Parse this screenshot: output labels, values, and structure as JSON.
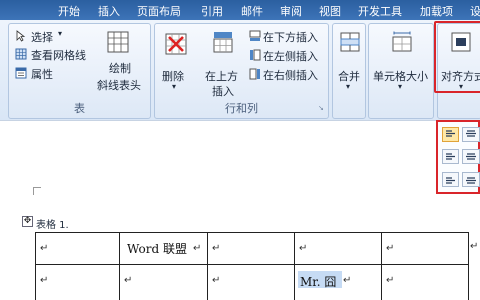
{
  "tabs": [
    "开始",
    "插入",
    "页面布局",
    "引用",
    "邮件",
    "审阅",
    "视图",
    "开发工具",
    "加载项",
    "设"
  ],
  "table_group": {
    "select": "选择",
    "view_gridlines": "查看网格线",
    "properties": "属性",
    "draw_line1": "绘制",
    "draw_line2": "斜线表头",
    "title": "表"
  },
  "rows_group": {
    "delete": "删除",
    "insert_above_line1": "在上方",
    "insert_above_line2": "插入",
    "insert_below": "在下方插入",
    "insert_left": "在左侧插入",
    "insert_right": "在右侧插入",
    "title": "行和列"
  },
  "merge": "合并",
  "cell_size": "单元格大小",
  "alignment": "对齐方式",
  "doc": {
    "table_caption": "表格 1.",
    "cell_word": "Word 联盟",
    "cell_mr": "Mr. 囧",
    "para_mark": "↵"
  },
  "colors": {
    "accent": "#2b5fa0",
    "highlight": "#d9252a",
    "selection": "#c6dbf4"
  }
}
